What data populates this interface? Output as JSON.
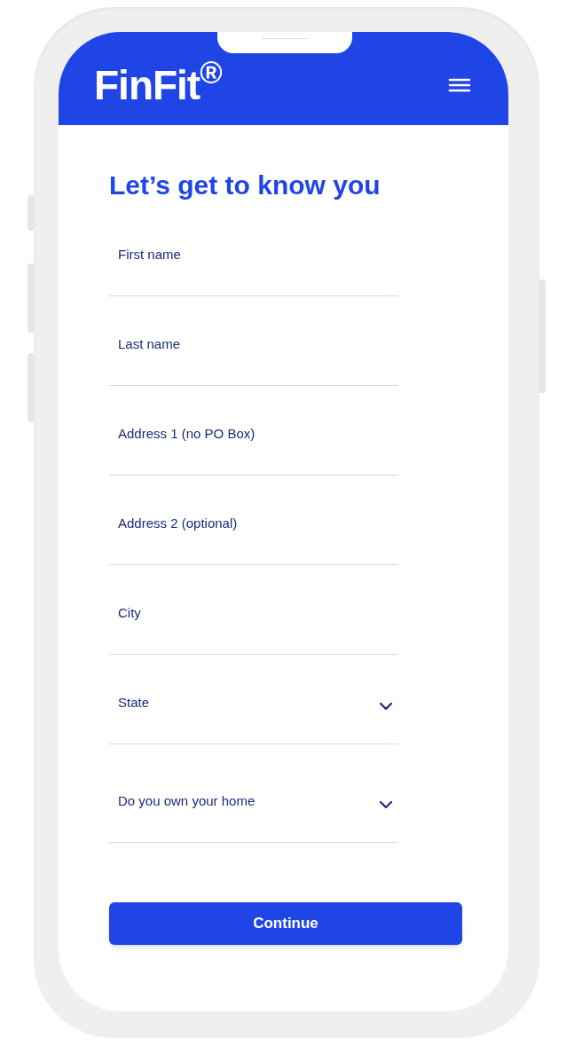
{
  "header": {
    "logo": "FinFit$^{®}$"
  },
  "title": "Let’s get to know you",
  "fields": [
    {
      "kind": "text",
      "label": "First name"
    },
    {
      "kind": "text",
      "label": "Last name"
    },
    {
      "kind": "text",
      "label": "Address 1 (no PO Box)"
    },
    {
      "kind": "text",
      "label": "Address 2 (optional)"
    },
    {
      "kind": "text",
      "label": "City"
    },
    {
      "kind": "select",
      "label": "State"
    },
    {
      "kind": "select",
      "label": "Do you own your home"
    }
  ],
  "button": "Continue"
}
